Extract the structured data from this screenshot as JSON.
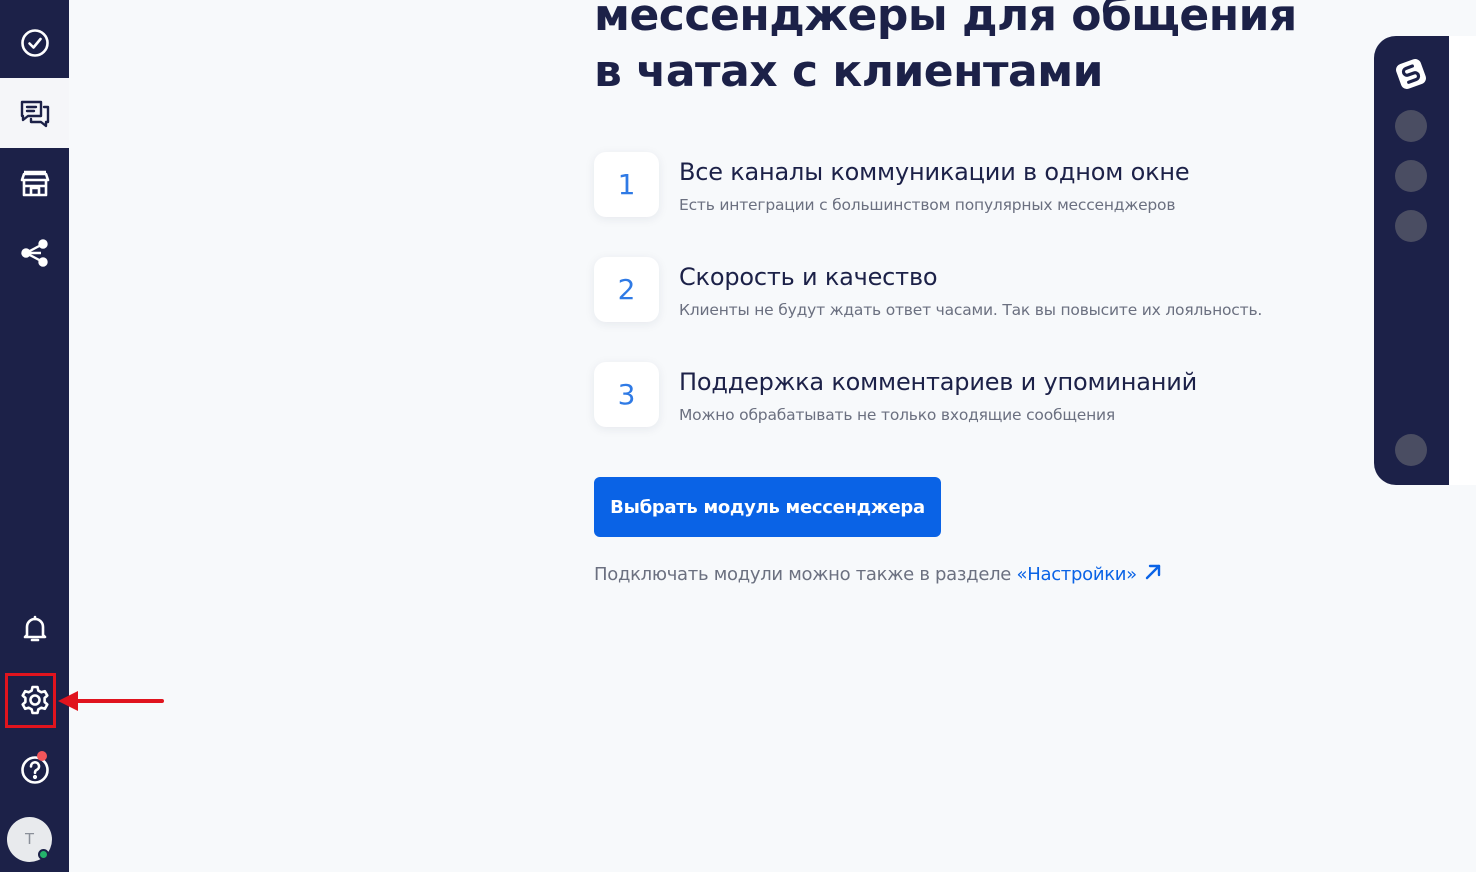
{
  "sidebar": {
    "items": [
      {
        "name": "tasks",
        "icon": "check-circle-icon"
      },
      {
        "name": "chats",
        "icon": "chat-bubbles-icon",
        "active": true
      },
      {
        "name": "marketplace",
        "icon": "store-icon"
      },
      {
        "name": "integrations",
        "icon": "share-nodes-icon"
      }
    ],
    "bottom": [
      {
        "name": "notifications",
        "icon": "bell-icon"
      },
      {
        "name": "settings",
        "icon": "gear-icon"
      },
      {
        "name": "help",
        "icon": "question-circle-icon"
      }
    ],
    "avatar_initial": "T"
  },
  "main": {
    "headline_line1": "мессенджеры для общения",
    "headline_line2": "в чатах с клиентами",
    "features": [
      {
        "number": "1",
        "title": "Все каналы коммуникации в одном окне",
        "description": "Есть интеграции с большинством популярных мессенджеров"
      },
      {
        "number": "2",
        "title": "Скорость и качество",
        "description": "Клиенты не будут ждать ответ часами. Так вы повысите их лояльность."
      },
      {
        "number": "3",
        "title": "Поддержка комментариев и упоминаний",
        "description": "Можно обрабатывать не только входящие сообщения"
      }
    ],
    "cta_label": "Выбрать модуль мессенджера",
    "hint_text": "Подключать модули можно также в разделе ",
    "hint_link": "«Настройки»"
  },
  "colors": {
    "sidebar_bg": "#1c2148",
    "accent": "#0a63e6",
    "number_color": "#2f7ae5",
    "highlight": "#e0141e"
  }
}
